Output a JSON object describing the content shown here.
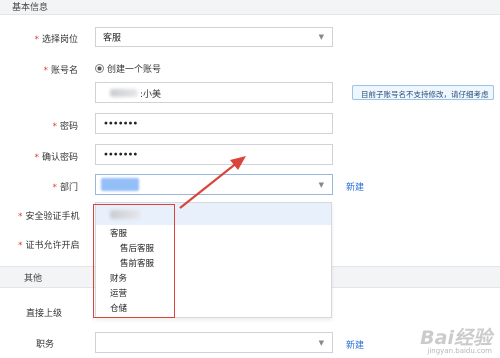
{
  "sections": {
    "basic": "基本信息",
    "other": "其他"
  },
  "form": {
    "position_label": "选择岗位",
    "position_value": "客服",
    "account_label": "账号名",
    "account_option": "创建一个账号",
    "account_value_suffix": ":小美",
    "account_tip": "目前子账号名不支持修改，请仔细考虑",
    "password_label": "密码",
    "password_value": "•••••••",
    "confirm_label": "确认密码",
    "confirm_value": "•••••••",
    "department_label": "部门",
    "new_link": "新建",
    "security_phone_label": "安全验证手机",
    "cert_label": "证书允许开启",
    "direct_superior_label": "直接上级",
    "duty_label": "职务",
    "duty_new_link": "新建"
  },
  "dropdown": {
    "items": [
      {
        "label": "客服",
        "indent": 0
      },
      {
        "label": "售后客服",
        "indent": 1
      },
      {
        "label": "售前客服",
        "indent": 1
      },
      {
        "label": "财务",
        "indent": 0
      },
      {
        "label": "运营",
        "indent": 0
      },
      {
        "label": "仓储",
        "indent": 0
      }
    ]
  },
  "watermark": {
    "brand": "Bai经验",
    "url": "jingyan.baidu.com"
  },
  "colors": {
    "required": "#e23b3b",
    "link": "#2a6fd6",
    "annotation": "#d9453b"
  }
}
